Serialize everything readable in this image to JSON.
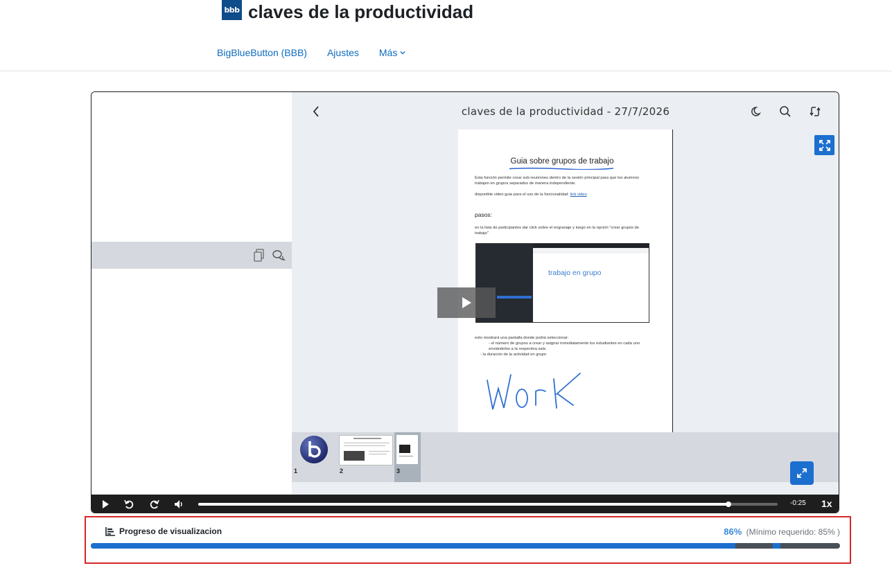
{
  "header": {
    "logo_text": "bbb",
    "title": "claves de la productividad",
    "nav": [
      {
        "label": "BigBlueButton (BBB)"
      },
      {
        "label": "Ajustes"
      },
      {
        "label": "Más"
      }
    ]
  },
  "player": {
    "recording_title": "claves de la productividad - 27/7/2026",
    "slide": {
      "heading": "Guia sobre grupos de trabajo",
      "intro": "Esta función permite crear sub-reuniones dentro de la sesión principal para que los alumnos trabajen en grupos separados de manera independiente.",
      "video_line": "disponible video guia para el uso de la funcionalidad:",
      "video_link": "link video",
      "pasos": "pasos:",
      "step_text": "en la lista de participantes dar click sobre el engranaje y luego en la opción \"crear grupos de trabajo\"",
      "screenshot_text": "trabajo en grupo",
      "after_text": "esto mostrará una pantalla donde podrá seleccionar:",
      "bullets": [
        "el número de grupos a crear y asignar inmediatamente los estudiantes en cada uno enviándolos a la respectiva sala",
        "la duración de la actividad en grupo"
      ],
      "handwriting": "WorK"
    },
    "thumbnails": [
      {
        "num": "1"
      },
      {
        "num": "2"
      },
      {
        "num": "3"
      }
    ],
    "time_remaining": "-0:25",
    "speed": "1x",
    "playback_progress": 0.915
  },
  "progress": {
    "title": "Progreso de visualizacion",
    "percent": "86%",
    "minimum": "(Mínimo requerido: 85% )",
    "value": 0.86,
    "marker_at": 0.91
  },
  "colors": {
    "accent": "#1c6fcf",
    "link": "#0f6cbf",
    "highlight_border": "#d62627"
  }
}
